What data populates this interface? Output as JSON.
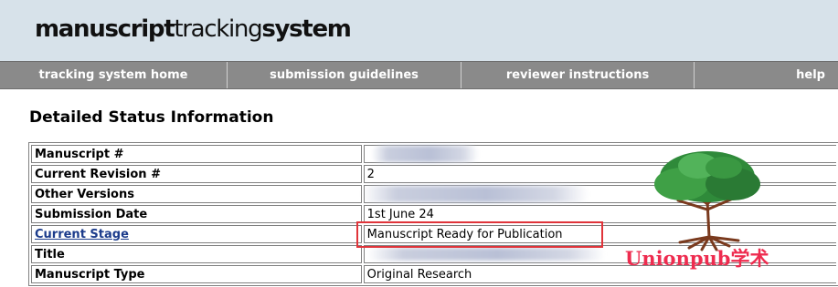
{
  "header": {
    "logo": {
      "part1": "manuscript",
      "part2": "tracking",
      "part3": "system"
    }
  },
  "nav": {
    "items": [
      {
        "label": "tracking system home"
      },
      {
        "label": "submission guidelines"
      },
      {
        "label": "reviewer instructions"
      },
      {
        "label": "help"
      }
    ]
  },
  "main": {
    "heading": "Detailed Status Information",
    "rows": [
      {
        "label": "Manuscript #",
        "value": ""
      },
      {
        "label": "Current Revision #",
        "value": "2"
      },
      {
        "label": "Other Versions",
        "value": ""
      },
      {
        "label": "Submission Date",
        "value": "1st June 24"
      },
      {
        "label": "Current Stage",
        "value": "Manuscript Ready for Publication"
      },
      {
        "label": "Title",
        "value": ""
      },
      {
        "label": "Manuscript Type",
        "value": "Original Research"
      }
    ]
  },
  "watermark": {
    "text": "Unionpub学术"
  }
}
